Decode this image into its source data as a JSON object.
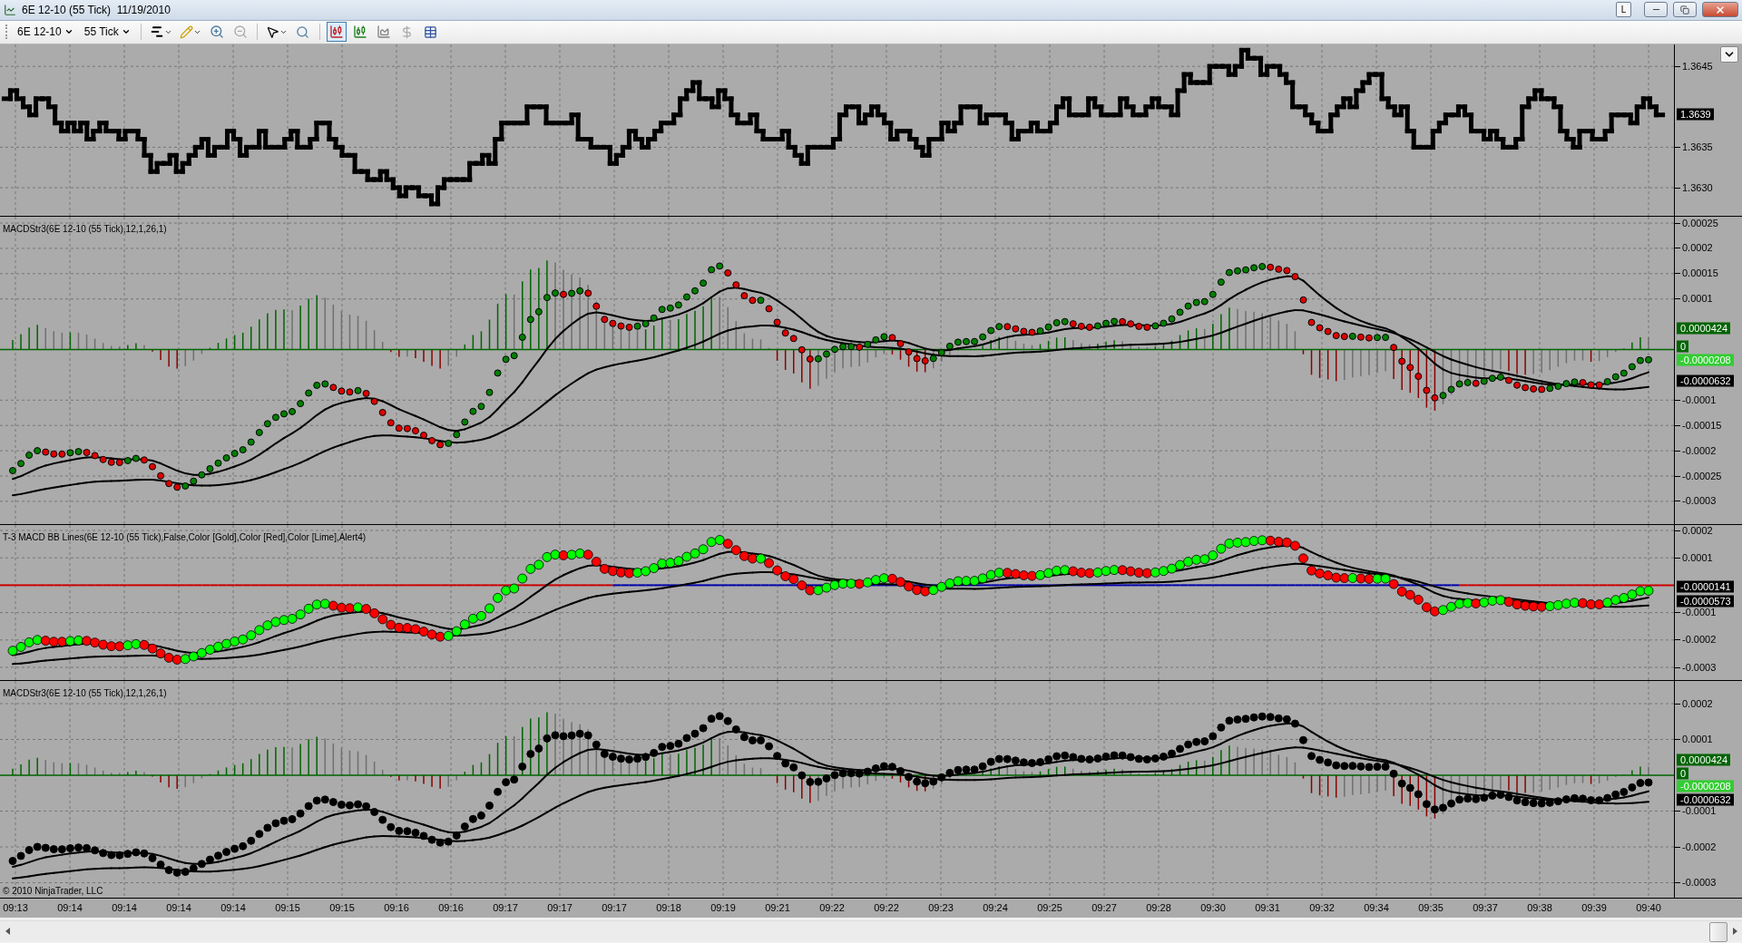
{
  "window": {
    "title": "6E 12-10 (55 Tick)  11/19/2010",
    "badge": "L"
  },
  "toolbar": {
    "instrument": "6E 12-10",
    "period": "55 Tick"
  },
  "panels": [
    {
      "kind": "price",
      "ticks": [
        "1.3645",
        "1.3635",
        "1.3630"
      ],
      "markers": [
        {
          "text": "1.3639",
          "color": "#000000"
        }
      ]
    },
    {
      "kind": "macd",
      "label": "MACDStr3(6E 12-10 (55 Tick),12,1,26,1)",
      "ticks": [
        "0.00025",
        "0.0002",
        "0.00015",
        "0.0001",
        "-0.0001",
        "-0.00015",
        "-0.0002",
        "-0.00025",
        "-0.0003"
      ],
      "markers": [
        {
          "text": "0.0000424",
          "color": "#006400"
        },
        {
          "text": "0",
          "color": "#006400"
        },
        {
          "text": "-0.0000208",
          "color": "#32cd32"
        },
        {
          "text": "-0.0000632",
          "color": "#000000"
        }
      ]
    },
    {
      "kind": "bblines",
      "label": "T-3 MACD BB Lines(6E 12-10 (55 Tick),False,Color [Gold],Color [Red],Color [Lime],Alert4)",
      "ticks": [
        "0.0002",
        "0.0001",
        "-0.0001",
        "-0.0002",
        "-0.0003"
      ],
      "markers": [
        {
          "text": "-0.0000141",
          "color": "#000000"
        },
        {
          "text": "-0.0000573",
          "color": "#000000"
        }
      ]
    },
    {
      "kind": "macd_mono",
      "label": "MACDStr3(6E 12-10 (55 Tick),12,1,26,1)",
      "ticks": [
        "0.0002",
        "0.0001",
        "-0.0001",
        "-0.0002",
        "-0.0003"
      ],
      "markers": [
        {
          "text": "0.0000424",
          "color": "#006400"
        },
        {
          "text": "0",
          "color": "#006400"
        },
        {
          "text": "-0.0000208",
          "color": "#32cd32"
        },
        {
          "text": "-0.0000632",
          "color": "#000000"
        }
      ],
      "copyright": "© 2010 NinjaTrader, LLC"
    }
  ],
  "time_axis": [
    "09:13",
    "09:14",
    "09:14",
    "09:14",
    "09:14",
    "09:15",
    "09:15",
    "09:16",
    "09:16",
    "09:17",
    "09:17",
    "09:17",
    "09:18",
    "09:19",
    "09:21",
    "09:22",
    "09:22",
    "09:23",
    "09:24",
    "09:25",
    "09:27",
    "09:28",
    "09:30",
    "09:31",
    "09:32",
    "09:34",
    "09:35",
    "09:37",
    "09:38",
    "09:39",
    "09:40"
  ]
}
